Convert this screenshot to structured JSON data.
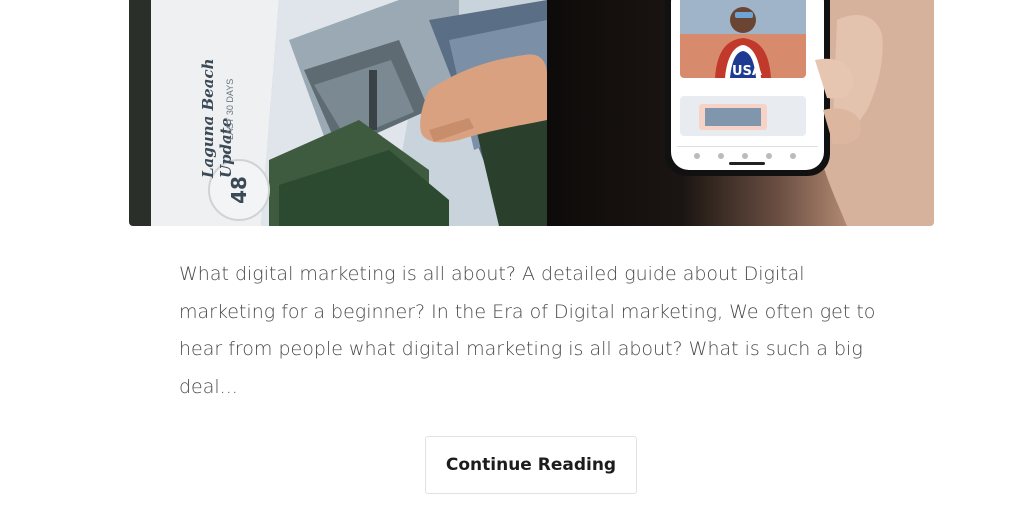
{
  "post": {
    "image_alt": "Hands holding a printed brochure and a smartphone",
    "brochure_title": "Laguna Beach Update",
    "brochure_subtitle": "LAST 30 DAYS",
    "brochure_number": "48",
    "phone_caption": "USA",
    "excerpt": "What digital marketing is all about? A detailed guide about Digital marketing for a beginner? In the Era of Digital marketing, We often get to hear from people what digital marketing is all about? What is such a big deal...",
    "continue_label": "Continue Reading"
  }
}
